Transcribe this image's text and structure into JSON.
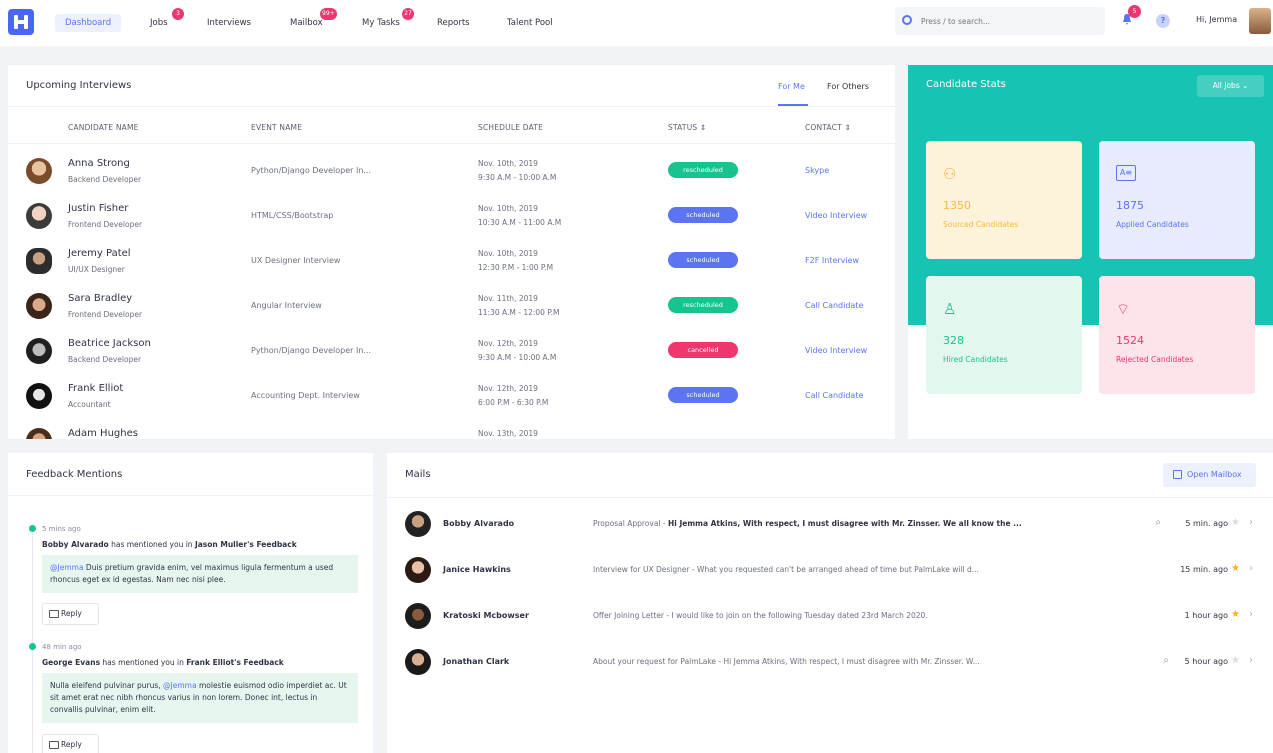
{
  "nav": {
    "items": [
      {
        "label": "Dashboard",
        "badge": ""
      },
      {
        "label": "Jobs",
        "badge": "3"
      },
      {
        "label": "Interviews",
        "badge": ""
      },
      {
        "label": "Mailbox",
        "badge": "99+"
      },
      {
        "label": "My Tasks",
        "badge": "27"
      },
      {
        "label": "Reports",
        "badge": ""
      },
      {
        "label": "Talent Pool",
        "badge": ""
      }
    ],
    "search_placeholder": "Press / to search...",
    "notification_badge": "5",
    "help": "?",
    "greeting": "Hi, Jemma"
  },
  "interviews": {
    "title": "Upcoming Interviews",
    "tabs": [
      "For Me",
      "For Others"
    ],
    "columns": [
      "CANDIDATE NAME",
      "EVENT NAME",
      "SCHEDULE DATE",
      "STATUS ⇕",
      "CONTACT ⇕"
    ],
    "rows": [
      {
        "name": "Anna Strong",
        "role": "Backend Developer",
        "event": "Python/Django Developer In...",
        "date": "Nov. 10th, 2019",
        "time": "9:30 A.M - 10:00 A.M",
        "status": "rescheduled",
        "contact": "Skype"
      },
      {
        "name": "Justin Fisher",
        "role": "Frontend Developer",
        "event": "HTML/CSS/Bootstrap",
        "date": "Nov. 10th, 2019",
        "time": "10:30 A.M - 11:00 A.M",
        "status": "scheduled",
        "contact": "Video Interview"
      },
      {
        "name": "Jeremy Patel",
        "role": "UI/UX Designer",
        "event": "UX Designer Interview",
        "date": "Nov. 10th, 2019",
        "time": "12:30 P.M - 1:00 P.M",
        "status": "scheduled",
        "contact": "F2F Interview"
      },
      {
        "name": "Sara Bradley",
        "role": "Frontend Developer",
        "event": "Angular Interview",
        "date": "Nov. 11th, 2019",
        "time": "11:30 A.M - 12:00 P.M",
        "status": "rescheduled",
        "contact": "Call Candidate"
      },
      {
        "name": "Beatrice Jackson",
        "role": "Backend Developer",
        "event": "Python/Django Developer In...",
        "date": "Nov. 12th, 2019",
        "time": "9:30 A.M - 10:00 A.M",
        "status": "cancelled",
        "contact": "Video Interview"
      },
      {
        "name": "Frank Elliot",
        "role": "Accountant",
        "event": "Accounting Dept. Interview",
        "date": "Nov. 12th, 2019",
        "time": "6:00 P.M - 6:30 P.M",
        "status": "scheduled",
        "contact": "Call Candidate"
      },
      {
        "name": "Adam Hughes",
        "role": "",
        "event": "",
        "date": "Nov. 13th, 2019",
        "time": "",
        "status": "",
        "contact": ""
      }
    ]
  },
  "stats": {
    "title": "Candidate Stats",
    "filter": "All Jobs ⌄",
    "cards": [
      {
        "value": "1350",
        "label": "Sourced Candidates",
        "icon": "group-icon",
        "color": "#f5b944",
        "bg": "#fdf2da"
      },
      {
        "value": "1875",
        "label": "Applied Candidates",
        "icon": "id-card-icon",
        "color": "#5b74f2",
        "bg": "#e8ebfd"
      },
      {
        "value": "328",
        "label": "Hired Candidates",
        "icon": "user-check-icon",
        "color": "#17c38e",
        "bg": "#e3f7ef"
      },
      {
        "value": "1524",
        "label": "Rejected Candidates",
        "icon": "thumbs-down-icon",
        "color": "#f0366e",
        "bg": "#fde3ea"
      }
    ]
  },
  "feedback": {
    "title": "Feedback Mentions",
    "items": [
      {
        "time": "5 mins ago",
        "user": "Bobby Alvarado",
        "mid": " has mentioned you in ",
        "target": "Jason Muller's Feedback",
        "mention": "@Jemma",
        "body": " Duis pretium gravida enim, vel maximus ligula fermentum a used rhoncus eget ex id egestas. Nam nec nisi plee.",
        "reply": "Reply"
      },
      {
        "time": "48 min ago",
        "user": "George Evans",
        "mid": " has mentioned you in ",
        "target": "Frank Elliot's Feedback",
        "pre": "Nulla eleifend pulvinar purus, ",
        "mention": "@Jemma",
        "body": " molestie euismod odio imperdiet ac. Ut sit amet erat nec nibh rhoncus varius in non lorem. Donec int, lectus in convallis pulvinar, enim elit.",
        "reply": "Reply"
      }
    ]
  },
  "mails": {
    "title": "Mails",
    "open_label": "Open Mailbox",
    "rows": [
      {
        "name": "Bobby Alvarado",
        "subject": "Proposal Approval - ",
        "preview": "Hi Jemma Atkins, With respect, I must disagree with Mr. Zinsser. We all know the ...",
        "bold": true,
        "time": "5 min. ago",
        "starred": false,
        "attach": true
      },
      {
        "name": "Janice Hawkins",
        "subject": "Interview for UX Designer - ",
        "preview": "What you requested can't be arranged ahead of time but PalmLake will d...",
        "bold": false,
        "time": "15 min. ago",
        "starred": true,
        "attach": false
      },
      {
        "name": "Kratoski Mcbowser",
        "subject": "Offer Joining Letter - ",
        "preview": "I would like to join on the following Tuesday dated 23rd March 2020.",
        "bold": false,
        "time": "1 hour ago",
        "starred": true,
        "attach": false
      },
      {
        "name": "Jonathan Clark",
        "subject": "About your request for PalmLake - ",
        "preview": "Hi Jemma Atkins, With respect, I must disagree with Mr. Zinsser. W...",
        "bold": false,
        "time": "5 hour ago",
        "starred": false,
        "attach": true
      }
    ]
  },
  "colors": {
    "accent": "#5b74f2",
    "teal": "#17c3b2",
    "green": "#17c38e",
    "red": "#f0366e",
    "star": "#f5b320"
  }
}
